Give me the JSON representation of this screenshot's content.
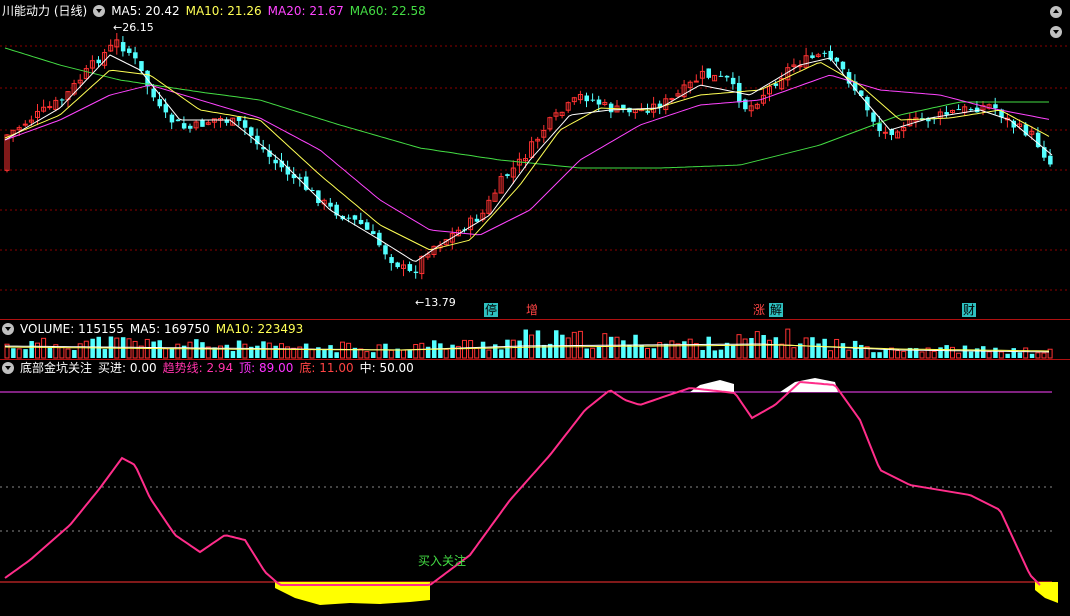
{
  "header": {
    "stock_name": "川能动力 (日线)",
    "ma": [
      {
        "label": "MA5: 20.42",
        "color": "#ffffff"
      },
      {
        "label": "MA10: 21.26",
        "color": "#ffff55"
      },
      {
        "label": "MA20: 21.67",
        "color": "#ff44ff"
      },
      {
        "label": "MA60: 22.58",
        "color": "#44dd44"
      }
    ],
    "high_label": "26.15",
    "low_label": "13.79"
  },
  "events": [
    {
      "label": "停",
      "color": "#2ec0c0",
      "text_color": "#000000"
    },
    {
      "label": "增",
      "color": "#000000",
      "text_color": "#ff4444"
    },
    {
      "label": "涨",
      "color": "#000000",
      "text_color": "#ff4444"
    },
    {
      "label": "解",
      "color": "#2ec0c0",
      "text_color": "#000000"
    },
    {
      "label": "财",
      "color": "#2ec0c0",
      "text_color": "#000000"
    }
  ],
  "volume_header": [
    {
      "label": "VOLUME: 115155",
      "color": "#ffffff"
    },
    {
      "label": "MA5: 169750",
      "color": "#ffffff"
    },
    {
      "label": "MA10: 223493",
      "color": "#ffff55"
    }
  ],
  "indicator_header": {
    "name": "底部金坑关注",
    "items": [
      {
        "label": "买进: 0.00",
        "color": "#ffffff"
      },
      {
        "label": "趋势线: 2.94",
        "color": "#ff33aa"
      },
      {
        "label": "顶: 89.00",
        "color": "#ff33ff"
      },
      {
        "label": "底: 11.00",
        "color": "#ff4444"
      },
      {
        "label": "中: 50.00",
        "color": "#ffffff"
      }
    ],
    "buy_label": "买入关注"
  },
  "colors": {
    "up": "#ff3232",
    "down": "#54ffff",
    "ma5": "#ffffff",
    "ma10": "#ffff55",
    "ma20": "#ff44ff",
    "ma60": "#44dd44",
    "trend": "#ff2d8a",
    "pit": "#ffff00",
    "grid": "#8b0000"
  }
}
